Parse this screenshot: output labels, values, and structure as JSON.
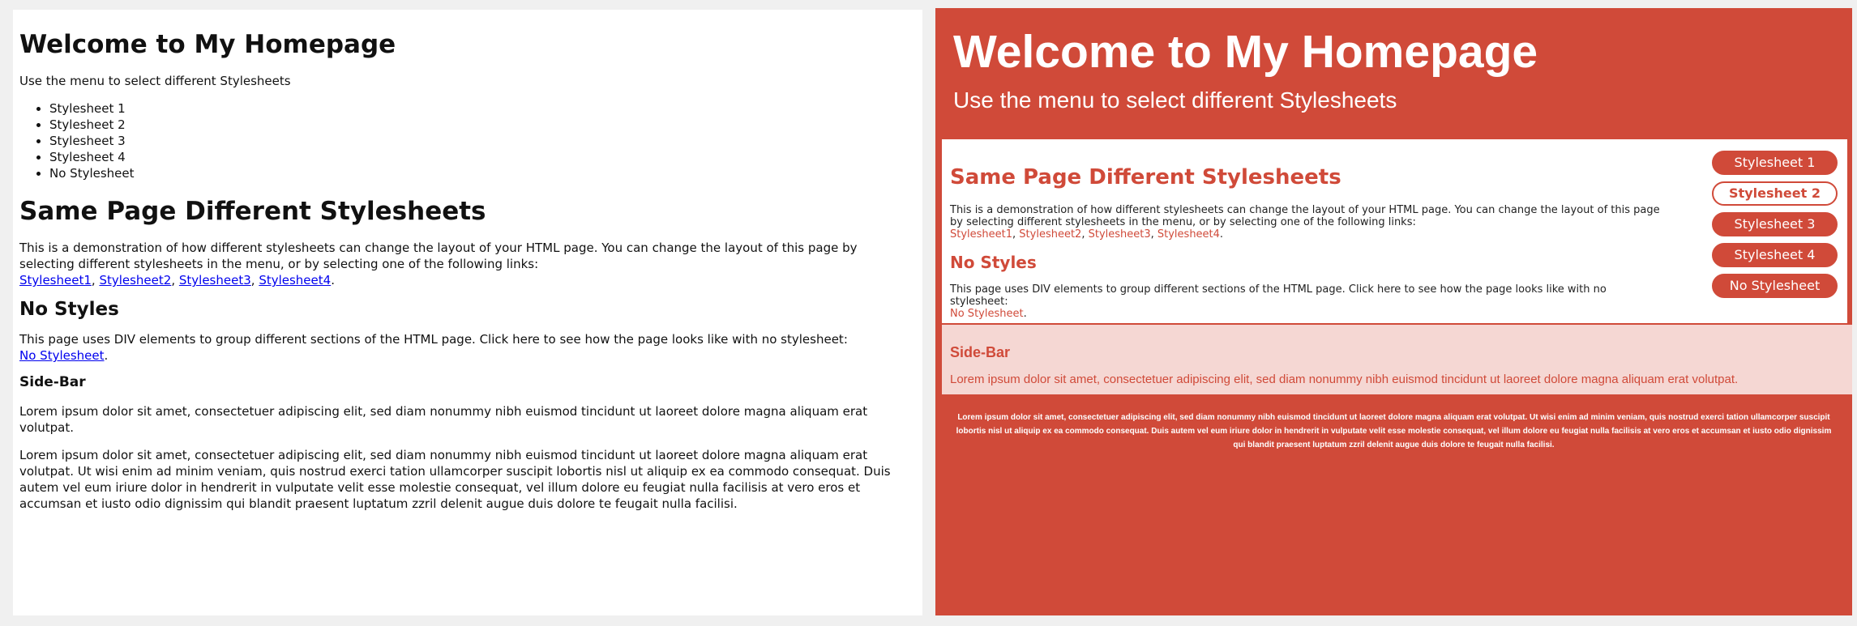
{
  "left": {
    "title": "Welcome to My Homepage",
    "intro": "Use the menu to select different Stylesheets",
    "menu_items": [
      "Stylesheet 1",
      "Stylesheet 2",
      "Stylesheet 3",
      "Stylesheet 4",
      "No Stylesheet"
    ],
    "section_title": "Same Page Different Stylesheets",
    "section_text": "This is a demonstration of how different stylesheets can change the layout of your HTML page. You can change the layout of this page by selecting different stylesheets in the menu, or by selecting one of the following links:",
    "links": [
      "Stylesheet1",
      "Stylesheet2",
      "Stylesheet3",
      "Stylesheet4"
    ],
    "no_styles_title": "No Styles",
    "no_styles_text": "This page uses DIV elements to group different sections of the HTML page. Click here to see how the page looks like with no stylesheet:",
    "no_stylesheet_link": "No Stylesheet",
    "sidebar_title": "Side-Bar",
    "sidebar_text": "Lorem ipsum dolor sit amet, consectetuer adipiscing elit, sed diam nonummy nibh euismod tincidunt ut laoreet dolore magna aliquam erat volutpat.",
    "footer_text": "Lorem ipsum dolor sit amet, consectetuer adipiscing elit, sed diam nonummy nibh euismod tincidunt ut laoreet dolore magna aliquam erat volutpat. Ut wisi enim ad minim veniam, quis nostrud exerci tation ullamcorper suscipit lobortis nisl ut aliquip ex ea commodo consequat. Duis autem vel eum iriure dolor in hendrerit in vulputate velit esse molestie consequat, vel illum dolore eu feugiat nulla facilisis at vero eros et accumsan et iusto odio dignissim qui blandit praesent luptatum zzril delenit augue duis dolore te feugait nulla facilisi."
  },
  "right": {
    "title": "Welcome to My Homepage",
    "intro": "Use the menu to select different Stylesheets",
    "section_title": "Same Page Different Stylesheets",
    "section_text": "This is a demonstration of how different stylesheets can change the layout of your HTML page. You can change the layout of this page by selecting different stylesheets in the menu, or by selecting one of the following links:",
    "links": [
      "Stylesheet1",
      "Stylesheet2",
      "Stylesheet3",
      "Stylesheet4"
    ],
    "no_styles_title": "No Styles",
    "no_styles_text": "This page uses DIV elements to group different sections of the HTML page. Click here to see how the page looks like with no stylesheet:",
    "no_stylesheet_link": "No Stylesheet",
    "menu_buttons": [
      "Stylesheet 1",
      "Stylesheet 2",
      "Stylesheet 3",
      "Stylesheet 4",
      "No Stylesheet"
    ],
    "active_button": "Stylesheet 2",
    "sidebar_title": "Side-Bar",
    "sidebar_text": "Lorem ipsum dolor sit amet, consectetuer adipiscing elit, sed diam nonummy nibh euismod tincidunt ut laoreet dolore magna aliquam erat volutpat.",
    "footer_text": "Lorem ipsum dolor sit amet, consectetuer adipiscing elit, sed diam nonummy nibh euismod tincidunt ut laoreet dolore magna aliquam erat volutpat. Ut wisi enim ad minim veniam, quis nostrud exerci tation ullamcorper suscipit lobortis nisl ut aliquip ex ea commodo consequat. Duis autem vel eum iriure dolor in hendrerit in vulputate velit esse molestie consequat, vel illum dolore eu feugiat nulla facilisis at vero eros et accumsan et iusto odio dignissim qui blandit praesent luptatum zzril delenit augue duis dolore te feugait nulla facilisi."
  },
  "colors": {
    "accent": "#d04a39",
    "sidebar_bg": "#f5d7d3",
    "link_blue": "#0000ee"
  }
}
